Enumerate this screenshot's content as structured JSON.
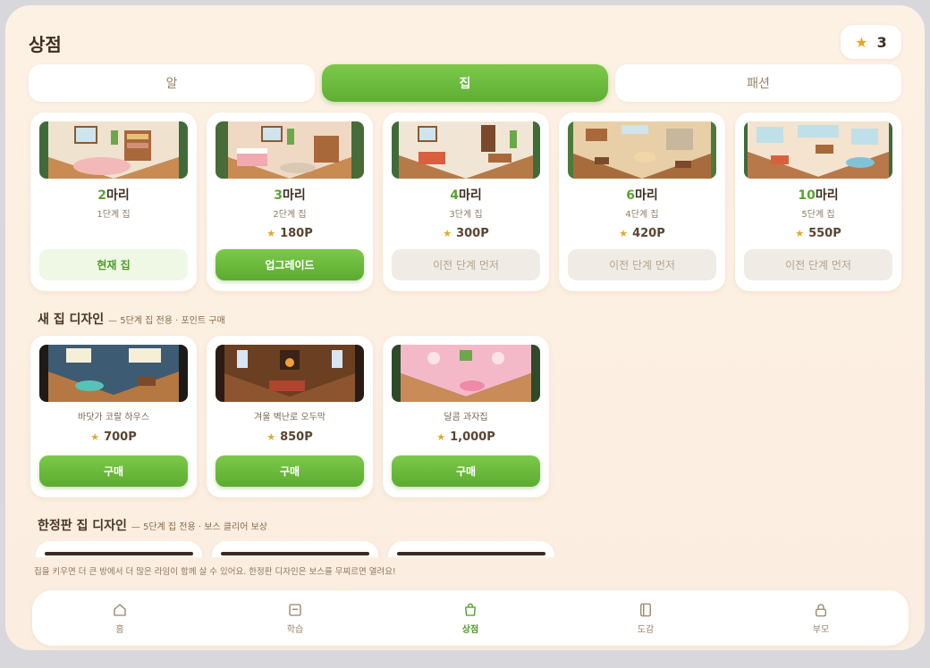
{
  "header": {
    "title": "상점",
    "star_icon": "star-icon",
    "star_count": "3"
  },
  "tabs": [
    {
      "label": "알",
      "active": false
    },
    {
      "label": "집",
      "active": true
    },
    {
      "label": "패션",
      "active": false
    }
  ],
  "houses": [
    {
      "count": "2",
      "count_suffix": "마리",
      "stage": "1단계 집",
      "price": "",
      "button": "현재 집",
      "state": "current"
    },
    {
      "count": "3",
      "count_suffix": "마리",
      "stage": "2단계 집",
      "price": "180P",
      "button": "업그레이드",
      "state": "upgrade"
    },
    {
      "count": "4",
      "count_suffix": "마리",
      "stage": "3단계 집",
      "price": "300P",
      "button": "이전 단계 먼저",
      "state": "locked"
    },
    {
      "count": "6",
      "count_suffix": "마리",
      "stage": "4단계 집",
      "price": "420P",
      "button": "이전 단계 먼저",
      "state": "locked"
    },
    {
      "count": "10",
      "count_suffix": "마리",
      "stage": "5단계 집",
      "price": "550P",
      "button": "이전 단계 먼저",
      "state": "locked"
    }
  ],
  "new_designs": {
    "title": "새 집 디자인",
    "subtitle": "— 5단계 집 전용 · 포인트 구매",
    "items": [
      {
        "name": "바닷가 코랄 하우스",
        "price": "700P",
        "button": "구매"
      },
      {
        "name": "겨울 벽난로 오두막",
        "price": "850P",
        "button": "구매"
      },
      {
        "name": "달콤 과자집",
        "price": "1,000P",
        "button": "구매"
      }
    ]
  },
  "limited_designs": {
    "title": "한정판 집 디자인",
    "subtitle": "— 5단계 집 전용 · 보스 클리어 보상"
  },
  "hint": "집을 키우면 더 큰 방에서 더 많은 라임이 함께 살 수 있어요. 한정판 디자인은 보스를 무찌르면 열려요!",
  "nav": [
    {
      "label": "홈",
      "icon": "home-icon",
      "active": false
    },
    {
      "label": "학습",
      "icon": "book-icon",
      "active": false
    },
    {
      "label": "상점",
      "icon": "shopping-bag-icon",
      "active": true
    },
    {
      "label": "도감",
      "icon": "notebook-icon",
      "active": false
    },
    {
      "label": "부모",
      "icon": "lock-icon",
      "active": false
    }
  ],
  "colors": {
    "accent_green": "#5fae33",
    "price_star": "#e3a72b",
    "background": "#fdf1e4"
  }
}
